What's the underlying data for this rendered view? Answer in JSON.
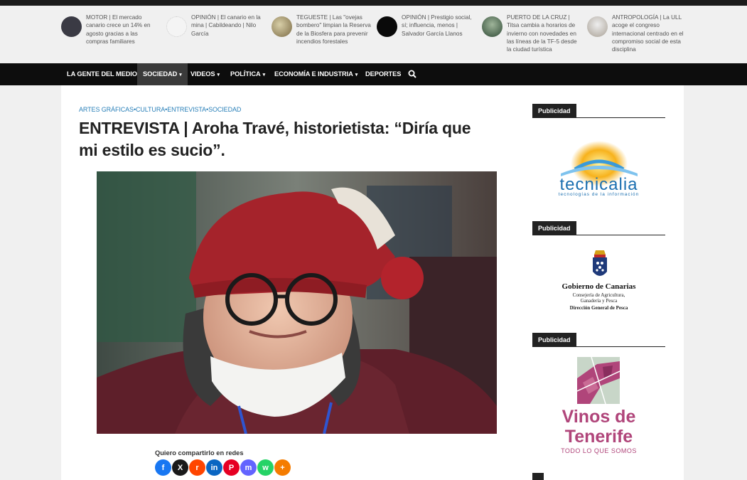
{
  "ticker": [
    {
      "text": "MOTOR | El mercado canario crece un 14% en agosto gracias a las compras familiares",
      "thumb_color": "#3a3a44"
    },
    {
      "text": "OPINIÓN | El canario en la mina | Cabildeando | Nilo García",
      "thumb_color": "#f4f4f4"
    },
    {
      "text": "TEGUESTE | Las \"ovejas bombero\" limpian la Reserva de la Biosfera para prevenir incendios forestales",
      "thumb_color": "#8a7a5a"
    },
    {
      "text": "OPINIÓN | Prestigio social, sí; influencia, menos | Salvador García Llanos",
      "thumb_color": "#0a0a0a"
    },
    {
      "text": "PUERTO DE LA CRUZ | Titsa cambia a horarios de invierno con novedades en las líneas de la TF-5 desde la ciudad turística",
      "thumb_color": "#4d6a55"
    },
    {
      "text": "ANTROPOLOGÍA | La ULL acoge el congreso internacional centrado en el compromiso social de esta disciplina",
      "thumb_color": "#c9c2b5"
    }
  ],
  "nav": {
    "items": [
      {
        "label": "LA GENTE DEL MEDIO",
        "dropdown": false
      },
      {
        "label": "SOCIEDAD",
        "dropdown": true,
        "active": true
      },
      {
        "label": "VIDEOS",
        "dropdown": true
      },
      {
        "label": "POLÍTICA",
        "dropdown": true
      },
      {
        "label": "ECONOMÍA E INDUSTRIA",
        "dropdown": true
      },
      {
        "label": "DEPORTES",
        "dropdown": false
      }
    ],
    "caret": "▾"
  },
  "article": {
    "categories": "ARTES GRÁFICAS•CULTURA•ENTREVISTA•SOCIEDAD",
    "title": "ENTREVISTA | Aroha Travé, historietista: “Diría que mi estilo es sucio”."
  },
  "share": {
    "label": "Quiero compartirlo en redes",
    "buttons": [
      {
        "icon": "facebook-icon",
        "glyph": "f",
        "color": "#1877f2"
      },
      {
        "icon": "x-icon",
        "glyph": "X",
        "color": "#1a1a1a"
      },
      {
        "icon": "reddit-icon",
        "glyph": "r",
        "color": "#ff4500"
      },
      {
        "icon": "linkedin-icon",
        "glyph": "in",
        "color": "#0a66c2"
      },
      {
        "icon": "pinterest-icon",
        "glyph": "P",
        "color": "#e60023"
      },
      {
        "icon": "mastodon-icon",
        "glyph": "m",
        "color": "#6364ff"
      },
      {
        "icon": "whatsapp-icon",
        "glyph": "w",
        "color": "#25d366"
      },
      {
        "icon": "more-icon",
        "glyph": "+",
        "color": "#f57c00"
      }
    ]
  },
  "sidebar": {
    "ad_label": "Publicidad",
    "ads": [
      {
        "brand": "tecnicalia",
        "tagline": "tecnologías de la información"
      },
      {
        "brand": "Gobierno de Canarias",
        "line1": "Consejería de Agricultura,",
        "line2": "Ganadería y Pesca",
        "line3": "Dirección General de Pesca"
      },
      {
        "brand_line1": "Vinos de",
        "brand_line2": "Tenerife",
        "tagline": "TODO LO QUE SOMOS"
      }
    ]
  },
  "colors": {
    "accent_link": "#2a80b9",
    "nav_bg": "#0d0d0d",
    "nav_active": "#3a3a3a",
    "wine": "#b0457a"
  }
}
